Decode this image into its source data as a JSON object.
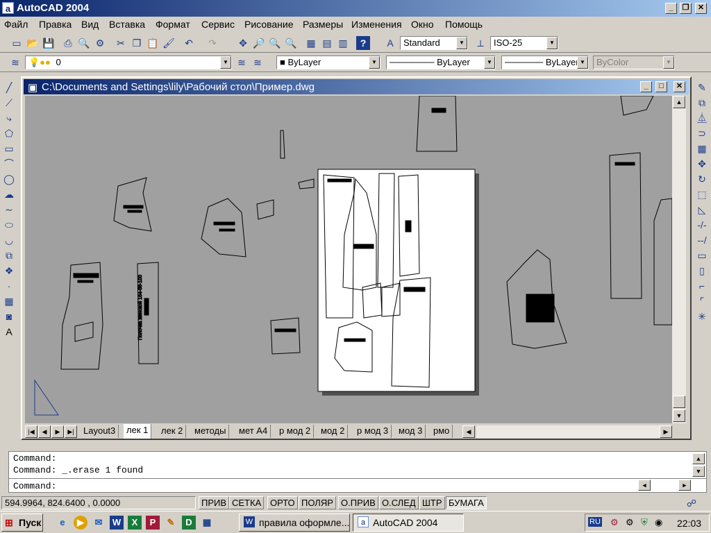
{
  "app": {
    "title": "AutoCAD 2004",
    "icon_glyph": "a"
  },
  "menu": [
    "Файл",
    "Правка",
    "Вид",
    "Вставка",
    "Формат",
    "Сервис",
    "Рисование",
    "Размеры",
    "Изменения",
    "Окно",
    "Помощь"
  ],
  "toolbar1": {
    "text_style": "Standard",
    "dim_style": "ISO-25"
  },
  "toolbar2": {
    "layer": "0",
    "color": "ByLayer",
    "linetype": "ByLayer",
    "lineweight": "ByLayer",
    "plotstyle": "ByColor"
  },
  "document": {
    "title": "C:\\Documents and Settings\\lily\\Рабочий стол\\Пример.dwg"
  },
  "tabs": [
    "Layout3",
    "лек 1",
    "лек 2",
    "методы",
    "мет А4",
    "р мод 2",
    "мод 2",
    "р мод 3",
    "мод 3",
    "рмо"
  ],
  "active_tab": "лек 1",
  "command": {
    "line1": "Command:",
    "line2": "Command: _.erase 1 found",
    "prompt": "Command:"
  },
  "status": {
    "coords": "594.9964, 824.6400 , 0.0000",
    "buttons": [
      "ПРИВ",
      "СЕТКА",
      "ОРТО",
      "ПОЛЯР",
      "О.ПРИВ",
      "О.СЛЕД",
      "ШТР",
      "БУМАГА"
    ]
  },
  "taskbar": {
    "start": "Пуск",
    "tasks": [
      "правила оформле...",
      "AutoCAD 2004"
    ],
    "lang": "RU",
    "clock": "22:03"
  },
  "drawing": {
    "label": "Полочка женской 164-88-100"
  },
  "colors": {
    "title_start": "#0a246a",
    "title_end": "#a6caf0",
    "canvas": "#a0a0a0"
  }
}
